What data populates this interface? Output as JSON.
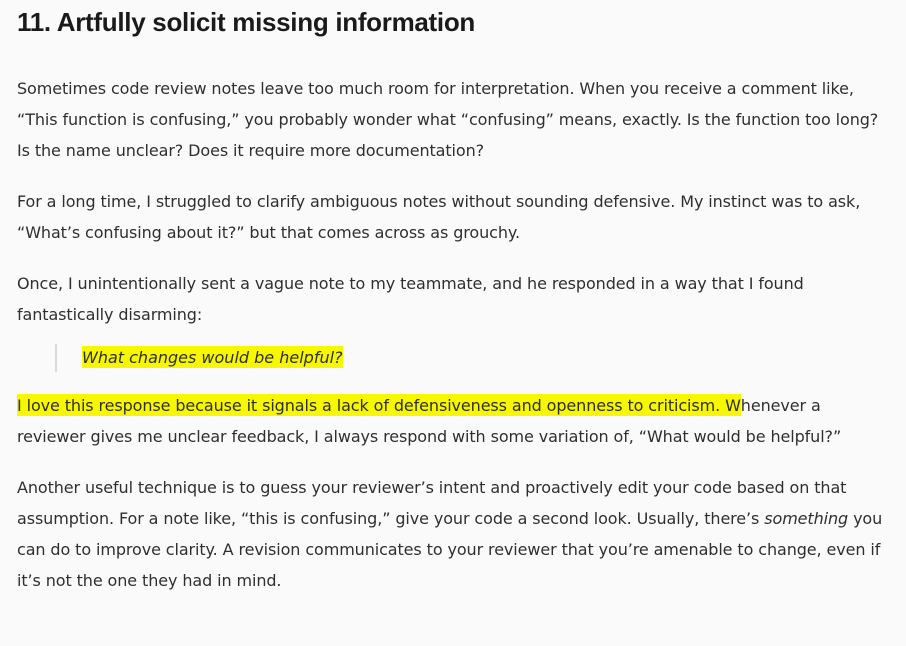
{
  "section": {
    "heading": "11. Artfully solicit missing information",
    "paragraphs": {
      "p1": "Sometimes code review notes leave too much room for interpretation. When you receive a comment like, “This function is confusing,” you probably wonder what “confusing” means, exactly. Is the function too long? Is the name unclear? Does it require more documentation?",
      "p2": "For a long time, I struggled to clarify ambiguous notes without sounding defensive. My instinct was to ask, “What’s confusing about it?” but that comes across as grouchy.",
      "p3": "Once, I unintentionally sent a vague note to my teammate, and he responded in a way that I found fantastically disarming:",
      "quote": "What changes would be helpful?",
      "p4_highlight": "I love this response because it signals a lack of defensiveness and openness to criticism. W",
      "p4_rest": "henever a reviewer gives me unclear feedback, I always respond with some variation of, “What would be helpful?”",
      "p5_before": "Another useful technique is to guess your reviewer’s intent and proactively edit your code based on that assumption. For a note like, “this is confusing,” give your code a second look. Usually, there’s ",
      "p5_em": "something",
      "p5_after": " you can do to improve clarity. A revision communicates to your reviewer that you’re amenable to change, even if it’s not the one they had in mind."
    },
    "highlight_color": "#f7f700"
  }
}
